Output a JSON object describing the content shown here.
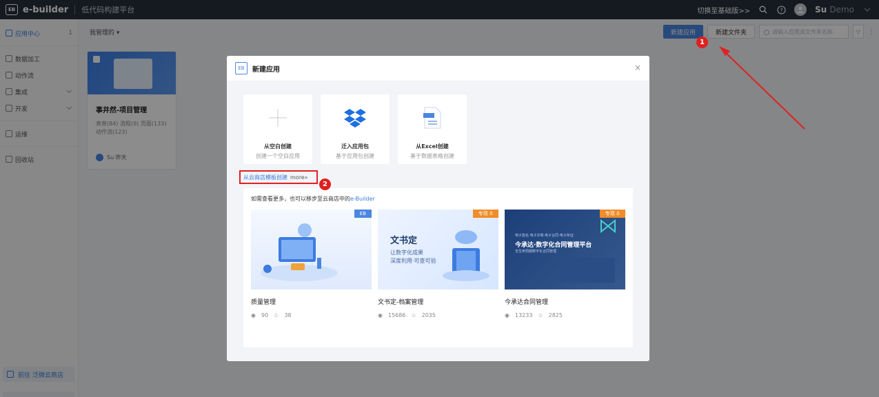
{
  "topbar": {
    "logo": "EB",
    "brand": "e-builder",
    "subtitle": "低代码构建平台",
    "switch_link": "切换至基础版>>",
    "user_name": "Su",
    "user_extra": "Demo"
  },
  "sidebar": {
    "items": [
      {
        "label": "应用中心",
        "count": "1"
      },
      {
        "label": "数据加工"
      },
      {
        "label": "动作流"
      },
      {
        "label": "集成"
      },
      {
        "label": "开发"
      },
      {
        "label": "运维"
      },
      {
        "label": "回收站"
      }
    ],
    "store_link": "前往 泛微云商店"
  },
  "toolbar": {
    "filter_label": "我管理的 ▾",
    "new_app": "新建应用",
    "new_folder": "新建文件夹",
    "search_placeholder": "请输入应用或文件夹名称"
  },
  "app_card": {
    "title": "事井然-项目管理",
    "meta": "表单(84) 流程(9) 页面(133) 动作流(123)",
    "owner": "Su 昨天"
  },
  "modal": {
    "badge": "EB",
    "title": "新建应用",
    "close": "×",
    "create_options": [
      {
        "title": "从空白创建",
        "subtitle": "创建一个空白应用"
      },
      {
        "title": "迁入应用包",
        "subtitle": "基于应用包创建"
      },
      {
        "title": "从Excel创建",
        "subtitle": "基于数据表格创建"
      }
    ],
    "store_link": "从云商店模板创建",
    "store_more": "more»",
    "store_hint_prefix": "如需查看更多，也可以移步至云商店中的",
    "store_hint_link": "e-Builder",
    "templates": [
      {
        "name": "质量管理",
        "views": "90",
        "likes": "38",
        "ribbon": "EB"
      },
      {
        "name": "文书定-档案管理",
        "views": "15686",
        "likes": "2035",
        "ribbon": "专项 ♁",
        "cover_title": "文书定",
        "cover_line1": "让数字化成果",
        "cover_line2": "深度利用·可查可验"
      },
      {
        "name": "今承达合同管理",
        "views": "13233",
        "likes": "2825",
        "ribbon": "专项 ♁",
        "cover_small": "电子签名·电子印章·电子合同·电子存证",
        "cover_title": "今承达·数字化合同管理平台",
        "cover_sub": "全生命周期数字化合同管理"
      }
    ]
  },
  "annotations": {
    "step1": "1",
    "step2": "2"
  },
  "colors": {
    "accent": "#4a86e0",
    "annotation": "#e02020",
    "topbar": "#27303d"
  }
}
